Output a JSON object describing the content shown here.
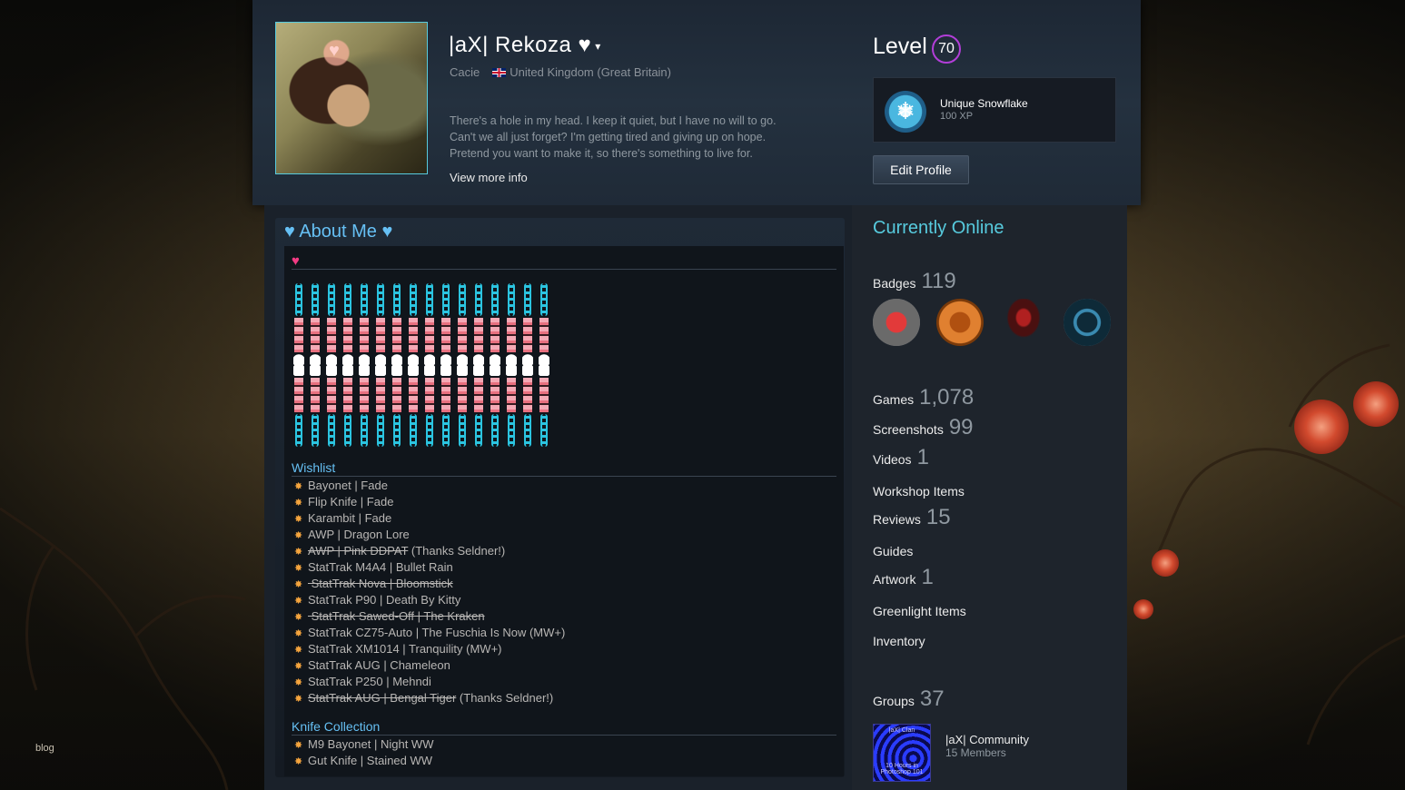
{
  "header": {
    "persona_name": "|aX| Rekoza ♥",
    "caret": "▾",
    "real_name": "Cacie",
    "country": "United Kingdom (Great Britain)",
    "summary_lines": [
      "There's a hole in my head. I keep it quiet, but I have no will to go.",
      "Can't we all just forget? I'm getting tired and giving up on hope.",
      "Pretend you want to make it, so there's something to live for."
    ],
    "view_more": "View more info",
    "level_label": "Level",
    "level": "70",
    "favorite_badge": {
      "title": "Unique Snowflake",
      "xp": "100 XP",
      "icon": "snowflake-icon"
    },
    "edit_profile": "Edit Profile"
  },
  "about": {
    "title": "♥ About Me ♥",
    "heart_icon": "pixel-heart-icon",
    "wishlist_title": "Wishlist",
    "wishlist": [
      {
        "text": "Bayonet | Fade",
        "struck": "",
        "note": ""
      },
      {
        "text": "Flip Knife | Fade",
        "struck": "",
        "note": ""
      },
      {
        "text": "Karambit | Fade",
        "struck": "",
        "note": ""
      },
      {
        "text": "AWP | Dragon Lore",
        "struck": "",
        "note": ""
      },
      {
        "text": "",
        "struck": "AWP | Pink DDPAT",
        "note": " (Thanks Seldner!)"
      },
      {
        "text": "StatTrak M4A4 | Bullet Rain",
        "struck": "",
        "note": ""
      },
      {
        "text": "",
        "struck": " StatTrak Nova | Bloomstick",
        "note": ""
      },
      {
        "text": "StatTrak P90 | Death By Kitty",
        "struck": "",
        "note": ""
      },
      {
        "text": "",
        "struck": " StatTrak Sawed-Off | The Kraken",
        "note": ""
      },
      {
        "text": "StatTrak CZ75-Auto | The Fuschia Is Now (MW+)",
        "struck": "",
        "note": ""
      },
      {
        "text": "StatTrak XM1014 | Tranquility (MW+)",
        "struck": "",
        "note": ""
      },
      {
        "text": "StatTrak AUG | Chameleon",
        "struck": "",
        "note": ""
      },
      {
        "text": "StatTrak P250 | Mehndi",
        "struck": "",
        "note": ""
      },
      {
        "text": "",
        "struck": "StatTrak AUG | Bengal Tiger",
        "note": " (Thanks Seldner!)"
      }
    ],
    "knife_title": "Knife Collection",
    "knives": [
      {
        "text": "M9 Bayonet | Night WW",
        "struck": "",
        "note": ""
      },
      {
        "text": "Gut Knife | Stained WW",
        "struck": "",
        "note": ""
      }
    ]
  },
  "sidebar": {
    "status": "Currently Online",
    "badges_label": "Badges",
    "badges_count": "119",
    "badges": [
      {
        "name": "heart-badge-icon",
        "color": "#d82a2a"
      },
      {
        "name": "gear-pickaxe-badge-icon",
        "color": "#d06a1a"
      },
      {
        "name": "character-badge-icon",
        "color": "#a02020"
      },
      {
        "name": "shield-emblem-badge-icon",
        "color": "#2a6a8a"
      }
    ],
    "stats": [
      {
        "label": "Games",
        "count": "1,078"
      },
      {
        "label": "Screenshots",
        "count": "99"
      },
      {
        "label": "Videos",
        "count": "1"
      },
      {
        "label": "Workshop Items",
        "count": ""
      },
      {
        "label": "Reviews",
        "count": "15"
      },
      {
        "label": "Guides",
        "count": ""
      },
      {
        "label": "Artwork",
        "count": "1"
      },
      {
        "label": "Greenlight Items",
        "count": ""
      },
      {
        "label": "Inventory",
        "count": ""
      }
    ],
    "groups_label": "Groups",
    "groups_count": "37",
    "group": {
      "name": "|aX| Community",
      "members": "15 Members",
      "avatar_top": "|aX| Clan",
      "avatar_bottom": "10 Hours in Photoshop 101"
    }
  },
  "footer": {
    "blog": "blog"
  },
  "colors": {
    "accent_blue": "#66c0f4",
    "online_cyan": "#57cbde",
    "level_purple": "#b23ed8"
  }
}
